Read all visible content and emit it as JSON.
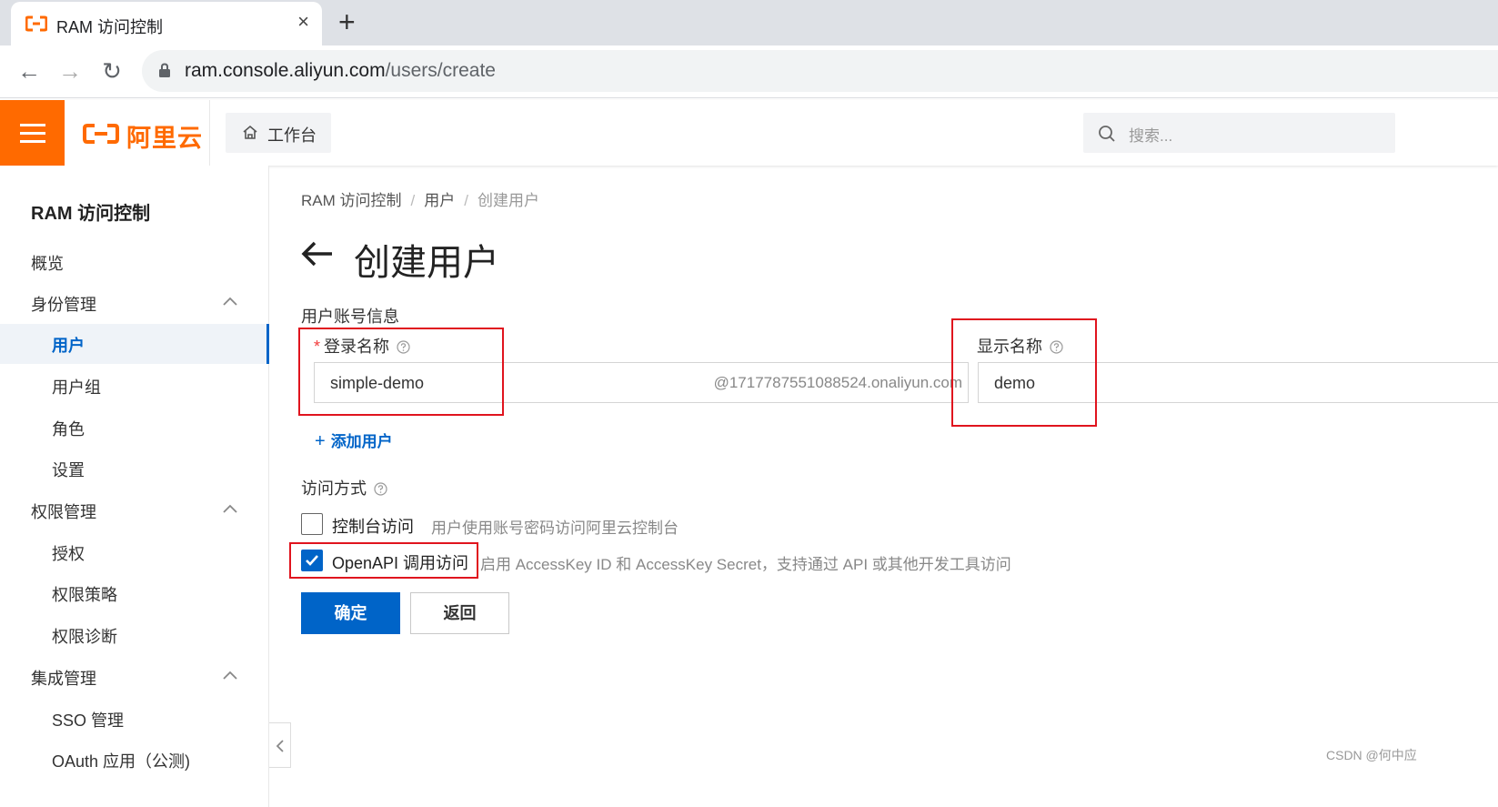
{
  "browser": {
    "tab_title": "RAM 访问控制",
    "close_glyph": "×",
    "new_tab_glyph": "+",
    "url_host": "ram.console.aliyun.com",
    "url_path": "/users/create",
    "back_glyph": "←",
    "forward_glyph": "→",
    "reload_glyph": "↻"
  },
  "topbar": {
    "brand": "阿里云",
    "workbench": "工作台",
    "search_placeholder": "搜索..."
  },
  "sidebar": {
    "title": "RAM 访问控制",
    "overview": "概览",
    "groups": [
      {
        "label": "身份管理",
        "items": [
          "用户",
          "用户组",
          "角色",
          "设置"
        ]
      },
      {
        "label": "权限管理",
        "items": [
          "授权",
          "权限策略",
          "权限诊断"
        ]
      },
      {
        "label": "集成管理",
        "items": [
          "SSO 管理",
          "OAuth 应用（公测)"
        ]
      }
    ],
    "active_item": "用户"
  },
  "breadcrumb": [
    "RAM 访问控制",
    "用户",
    "创建用户"
  ],
  "breadcrumb_sep": "/",
  "page_title": "创建用户",
  "form": {
    "section_account": "用户账号信息",
    "login_name_label": "登录名称",
    "required_mark": "*",
    "login_name_value": "simple-demo",
    "login_name_suffix": "@1717787551088524.onaliyun.com",
    "display_name_label": "显示名称",
    "display_name_value": "demo",
    "add_user": "添加用户",
    "add_user_plus": "+",
    "section_access": "访问方式",
    "console_access_label": "控制台访问",
    "console_access_desc": "用户使用账号密码访问阿里云控制台",
    "console_access_checked": false,
    "openapi_access_label": "OpenAPI 调用访问",
    "openapi_access_desc": "启用 AccessKey ID 和 AccessKey Secret，支持通过 API 或其他开发工具访问",
    "openapi_access_checked": true,
    "confirm_button": "确定",
    "back_button": "返回"
  },
  "watermark": "CSDN @何中应",
  "colors": {
    "brand_orange": "#ff6a00",
    "primary_blue": "#0064c8",
    "annotation_red": "#e0141e"
  }
}
